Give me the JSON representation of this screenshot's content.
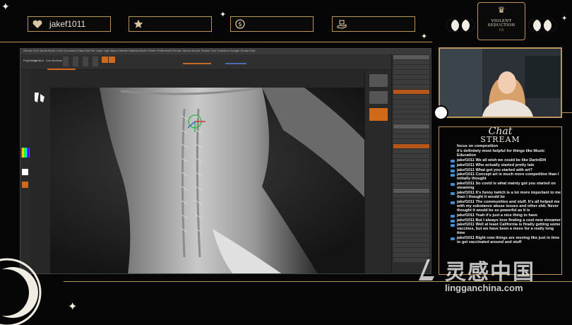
{
  "top_bar": {
    "follower_name": "jakef1011",
    "subscriber_name": "",
    "donation_name": "",
    "gift_name": ""
  },
  "icons": {
    "follower": "heart-icon",
    "subscriber": "star-icon",
    "donation": "dollar-icon",
    "gift": "gift-hand-icon"
  },
  "brand": {
    "logo_line1": "VIOLENT SEDUCTION",
    "logo_line2": "FX"
  },
  "zbrush": {
    "menu_text": "ZBrush 2021  Alpha  Brush  Color  Document  Draw  Edit  File  Layer  Light  Macro  Marker  Material  Movie  Picker  Preferences  Render  Stencil  Stroke  Texture  Tool  Transform  Zplugin  Zscript  Help",
    "toolbar_labels": [
      "Projection",
      "Lightbox",
      "Live Boolean"
    ]
  },
  "chat": {
    "title_script": "Chat",
    "title_caps": "STREAM",
    "messages": [
      {
        "user": "",
        "text": "focus on composition"
      },
      {
        "user": "",
        "text": "It's definitely most helpful for things like Music Education"
      },
      {
        "user": "jakef1011",
        "text": "We all wish we could be like Darin504"
      },
      {
        "user": "jakef1011",
        "text": "Who actually started pretty late"
      },
      {
        "user": "jakef1011",
        "text": "What got you started with art?"
      },
      {
        "user": "jakef1011",
        "text": "Concept art is much more competitive than I initially thought"
      },
      {
        "user": "jakef1011",
        "text": "So covid is what mainly got you started on steaming"
      },
      {
        "user": "jakef1011",
        "text": "It's funny twitch is a lot more important to me than I thought it would be"
      },
      {
        "user": "jakef1011",
        "text": "The communities and stuff. It's all helped me with my substance abuse issues and other shit. Never thought it would be so powerful as it is"
      },
      {
        "user": "jakef1011",
        "text": "Yeah it's just a nice thing to have"
      },
      {
        "user": "jakef1011",
        "text": "But I always love finding a cool new streamer"
      },
      {
        "user": "jakef1011",
        "text": "Well at least California is finally getting some vaccines, but we have been a mess for a really long time"
      },
      {
        "user": "jakef1011",
        "text": "Right now things are moving like just in time to get vaccinated around and stuff"
      }
    ]
  },
  "watermark": {
    "cn_text": "灵感中国",
    "url": "lingganchina.com"
  },
  "colors": {
    "gold": "#b8955a",
    "background": "#060606",
    "badge": "#3a8fd6"
  }
}
